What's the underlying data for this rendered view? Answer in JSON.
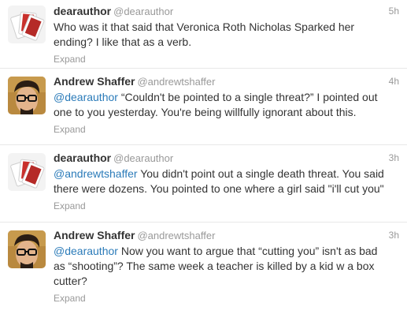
{
  "tweets": [
    {
      "fullname": "dearauthor",
      "username": "@dearauthor",
      "time": "5h",
      "text_before": "",
      "mention": "",
      "text_after": "Who was it that said that Veronica Roth Nicholas Sparked her ending? I like that as a verb.",
      "expand": "Expand",
      "avatar_icon": "playing-cards-avatar"
    },
    {
      "fullname": "Andrew Shaffer",
      "username": "@andrewtshaffer",
      "time": "4h",
      "text_before": "",
      "mention": "@dearauthor",
      "text_after": " “Couldn't be pointed to a single threat?” I pointed out one to you yesterday. You're being willfully ignorant about this.",
      "expand": "Expand",
      "avatar_icon": "man-with-glasses-avatar"
    },
    {
      "fullname": "dearauthor",
      "username": "@dearauthor",
      "time": "3h",
      "text_before": "",
      "mention": "@andrewtshaffer",
      "text_after": " You didn't point out a single death threat. You said there were dozens. You pointed to one where a girl said \"i'll cut you\"",
      "expand": "Expand",
      "avatar_icon": "playing-cards-avatar"
    },
    {
      "fullname": "Andrew Shaffer",
      "username": "@andrewtshaffer",
      "time": "3h",
      "text_before": "",
      "mention": "@dearauthor",
      "text_after": " Now you want to argue that “cutting you” isn't as bad as “shooting”? The same week a teacher is killed by a kid w a box cutter?",
      "expand": "Expand",
      "avatar_icon": "man-with-glasses-avatar"
    }
  ],
  "colors": {
    "link": "#2b7bb9",
    "meta": "#999999",
    "text": "#333333",
    "divider": "#e8e8e8"
  }
}
